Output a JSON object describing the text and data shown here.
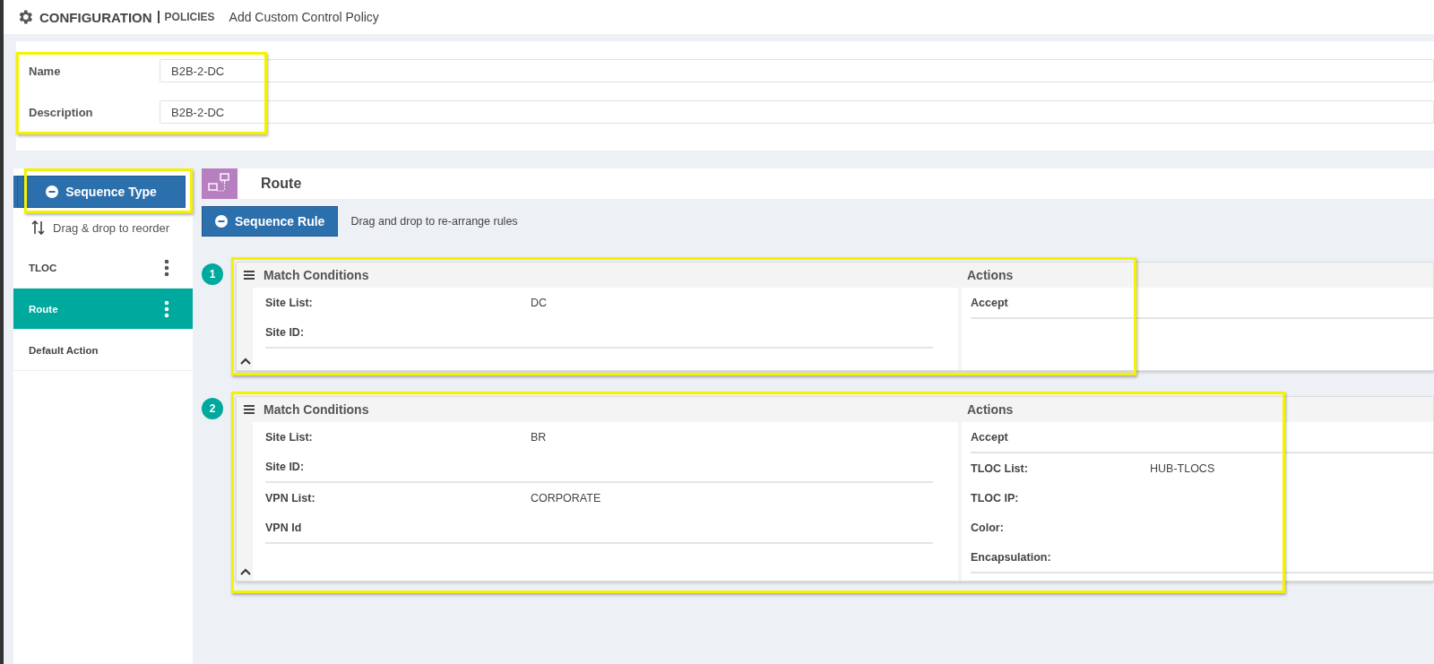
{
  "header": {
    "title": "CONFIGURATION",
    "section": "POLICIES",
    "page": "Add Custom Control Policy"
  },
  "policy": {
    "highlighted": true,
    "fields": [
      {
        "label": "Name",
        "value": "B2B-2-DC"
      },
      {
        "label": "Description",
        "value": "B2B-2-DC"
      }
    ]
  },
  "sidebar": {
    "button": "Sequence Type",
    "button_highlighted": true,
    "hint": "Drag & drop to reorder",
    "items": [
      {
        "label": "TLOC",
        "selected": false,
        "menu": true
      },
      {
        "label": "Route",
        "selected": true,
        "menu": true
      },
      {
        "label": "Default Action",
        "selected": false,
        "menu": false
      }
    ]
  },
  "main": {
    "title": "Route",
    "button": "Sequence Rule",
    "hint": "Drag and drop to re-arrange rules",
    "rules": [
      {
        "number": "1",
        "highlighted": true,
        "match_title": "Match Conditions",
        "actions_title": "Actions",
        "match_groups": [
          [
            {
              "label": "Site List:",
              "value": "DC"
            },
            {
              "label": "Site ID:"
            }
          ]
        ],
        "action_groups": [
          [
            {
              "label": "Accept"
            }
          ]
        ]
      },
      {
        "number": "2",
        "highlighted": true,
        "match_title": "Match Conditions",
        "actions_title": "Actions",
        "match_groups": [
          [
            {
              "label": "Site List:",
              "value": "BR"
            },
            {
              "label": "Site ID:"
            }
          ],
          [
            {
              "label": "VPN List:",
              "value": "CORPORATE"
            },
            {
              "label": "VPN Id"
            }
          ]
        ],
        "action_groups": [
          [
            {
              "label": "Accept"
            }
          ],
          [
            {
              "label": "TLOC List:",
              "value": "HUB-TLOCS"
            },
            {
              "label": "TLOC IP:"
            },
            {
              "label": "Color:"
            },
            {
              "label": "Encapsulation:"
            }
          ]
        ]
      }
    ]
  }
}
